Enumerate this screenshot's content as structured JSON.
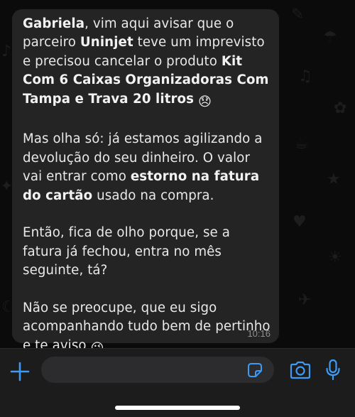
{
  "message": {
    "sender_name": "Gabriela",
    "p1_a": ", vim aqui avisar que o parceiro ",
    "partner": "Uninjet",
    "p1_b": " teve um imprevisto e precisou cancelar o produto ",
    "product": "Kit Com 6 Caixas Organizadoras Com Tampa e Trava 20 litros",
    "emoji_sad": "😞",
    "p2_a": "Mas olha só: já estamos agilizando a devolução do seu dinheiro. O valor vai entrar como ",
    "p2_bold": "estorno na fatura do cartão",
    "p2_b": " usado na compra.",
    "p3": "Então, fica de olho porque, se a fatura já fechou, entra no mês seguinte, tá?",
    "p4": "Não se preocupe, que eu sigo acompanhando tudo bem de pertinho e te aviso ",
    "emoji_wink": "😉",
    "time": "10:16"
  },
  "input_bar": {
    "placeholder": "",
    "icons": [
      "plus-icon",
      "sticker-icon",
      "camera-icon",
      "microphone-icon"
    ],
    "accent_color": "#3e9bf3"
  },
  "colors": {
    "background": "#0b0b0b",
    "bubble": "#242425",
    "text": "#e9e9ea",
    "timestamp": "#8e8e93"
  }
}
